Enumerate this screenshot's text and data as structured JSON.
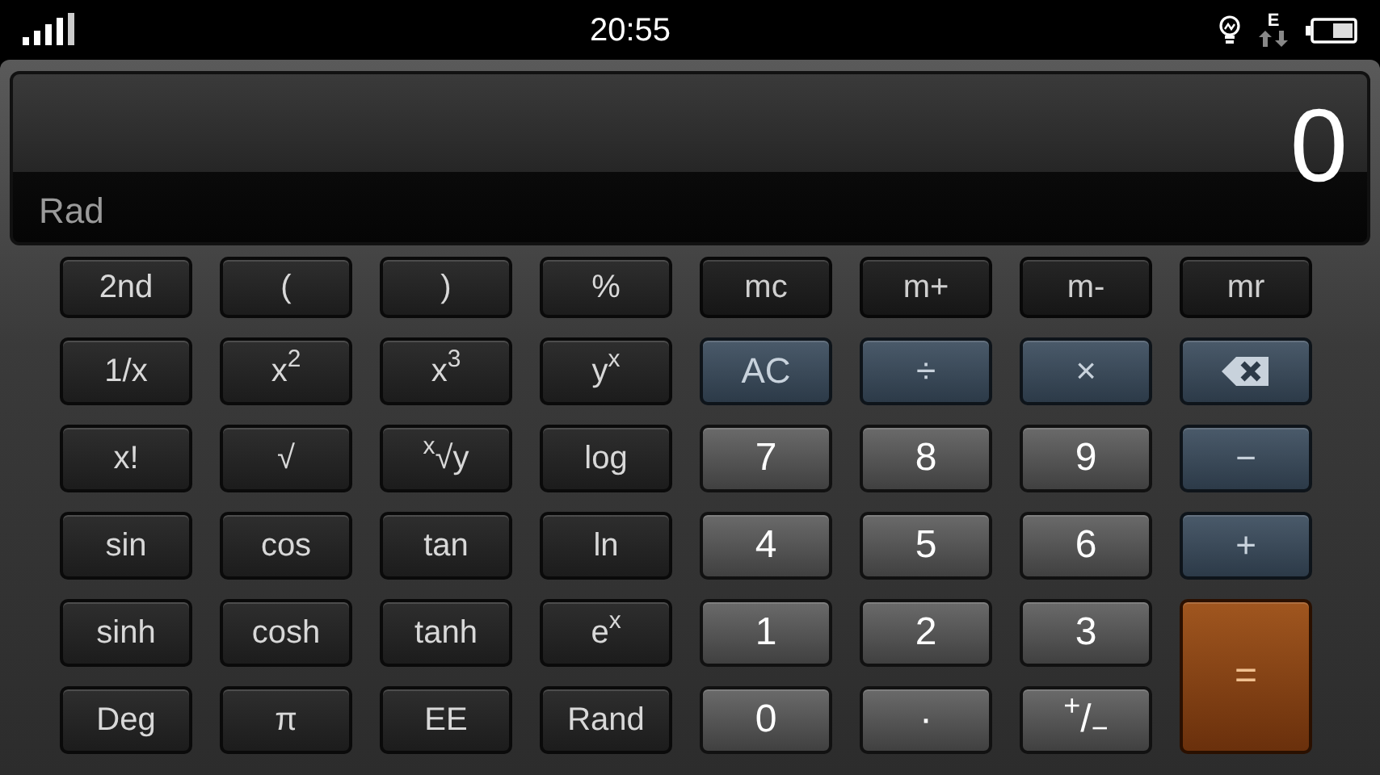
{
  "status_bar": {
    "time": "20:55",
    "network": "E"
  },
  "display": {
    "value": "0",
    "angle_mode": "Rad"
  },
  "keys": [
    {
      "label": "2nd",
      "kind": "function"
    },
    {
      "label": "(",
      "kind": "function"
    },
    {
      "label": ")",
      "kind": "function"
    },
    {
      "label": "%",
      "kind": "function"
    },
    {
      "label": "mc",
      "kind": "memory"
    },
    {
      "label": "m+",
      "kind": "memory"
    },
    {
      "label": "m-",
      "kind": "memory"
    },
    {
      "label": "mr",
      "kind": "memory"
    },
    {
      "label": "1/x",
      "kind": "function"
    },
    {
      "label": "x$^{2}$",
      "kind": "function"
    },
    {
      "label": "x$^{3}$",
      "kind": "function"
    },
    {
      "label": "y$^{x}$",
      "kind": "function"
    },
    {
      "label": "AC",
      "kind": "operator"
    },
    {
      "label": "÷",
      "kind": "operator"
    },
    {
      "label": "×",
      "kind": "operator"
    },
    {
      "kind": "backspace"
    },
    {
      "label": "x!",
      "kind": "function"
    },
    {
      "label": "√",
      "kind": "function"
    },
    {
      "label": "$^{x}$√y",
      "kind": "function"
    },
    {
      "label": "log",
      "kind": "function"
    },
    {
      "label": "7",
      "kind": "digit"
    },
    {
      "label": "8",
      "kind": "digit"
    },
    {
      "label": "9",
      "kind": "digit"
    },
    {
      "label": "−",
      "kind": "operator"
    },
    {
      "label": "sin",
      "kind": "function"
    },
    {
      "label": "cos",
      "kind": "function"
    },
    {
      "label": "tan",
      "kind": "function"
    },
    {
      "label": "ln",
      "kind": "function"
    },
    {
      "label": "4",
      "kind": "digit"
    },
    {
      "label": "5",
      "kind": "digit"
    },
    {
      "label": "6",
      "kind": "digit"
    },
    {
      "label": "+",
      "kind": "operator"
    },
    {
      "label": "sinh",
      "kind": "function"
    },
    {
      "label": "cosh",
      "kind": "function"
    },
    {
      "label": "tanh",
      "kind": "function"
    },
    {
      "label": "e$^{x}$",
      "kind": "function"
    },
    {
      "label": "1",
      "kind": "digit"
    },
    {
      "label": "2",
      "kind": "digit"
    },
    {
      "label": "3",
      "kind": "digit"
    },
    {
      "label": "=",
      "kind": "equals"
    },
    {
      "label": "Deg",
      "kind": "function"
    },
    {
      "label": "π",
      "kind": "function"
    },
    {
      "label": "EE",
      "kind": "function"
    },
    {
      "label": "Rand",
      "kind": "function"
    },
    {
      "label": "0",
      "kind": "digit"
    },
    {
      "label": "·",
      "kind": "digit"
    },
    {
      "label": "$^{+}$/$_{−}$",
      "kind": "digit"
    }
  ]
}
